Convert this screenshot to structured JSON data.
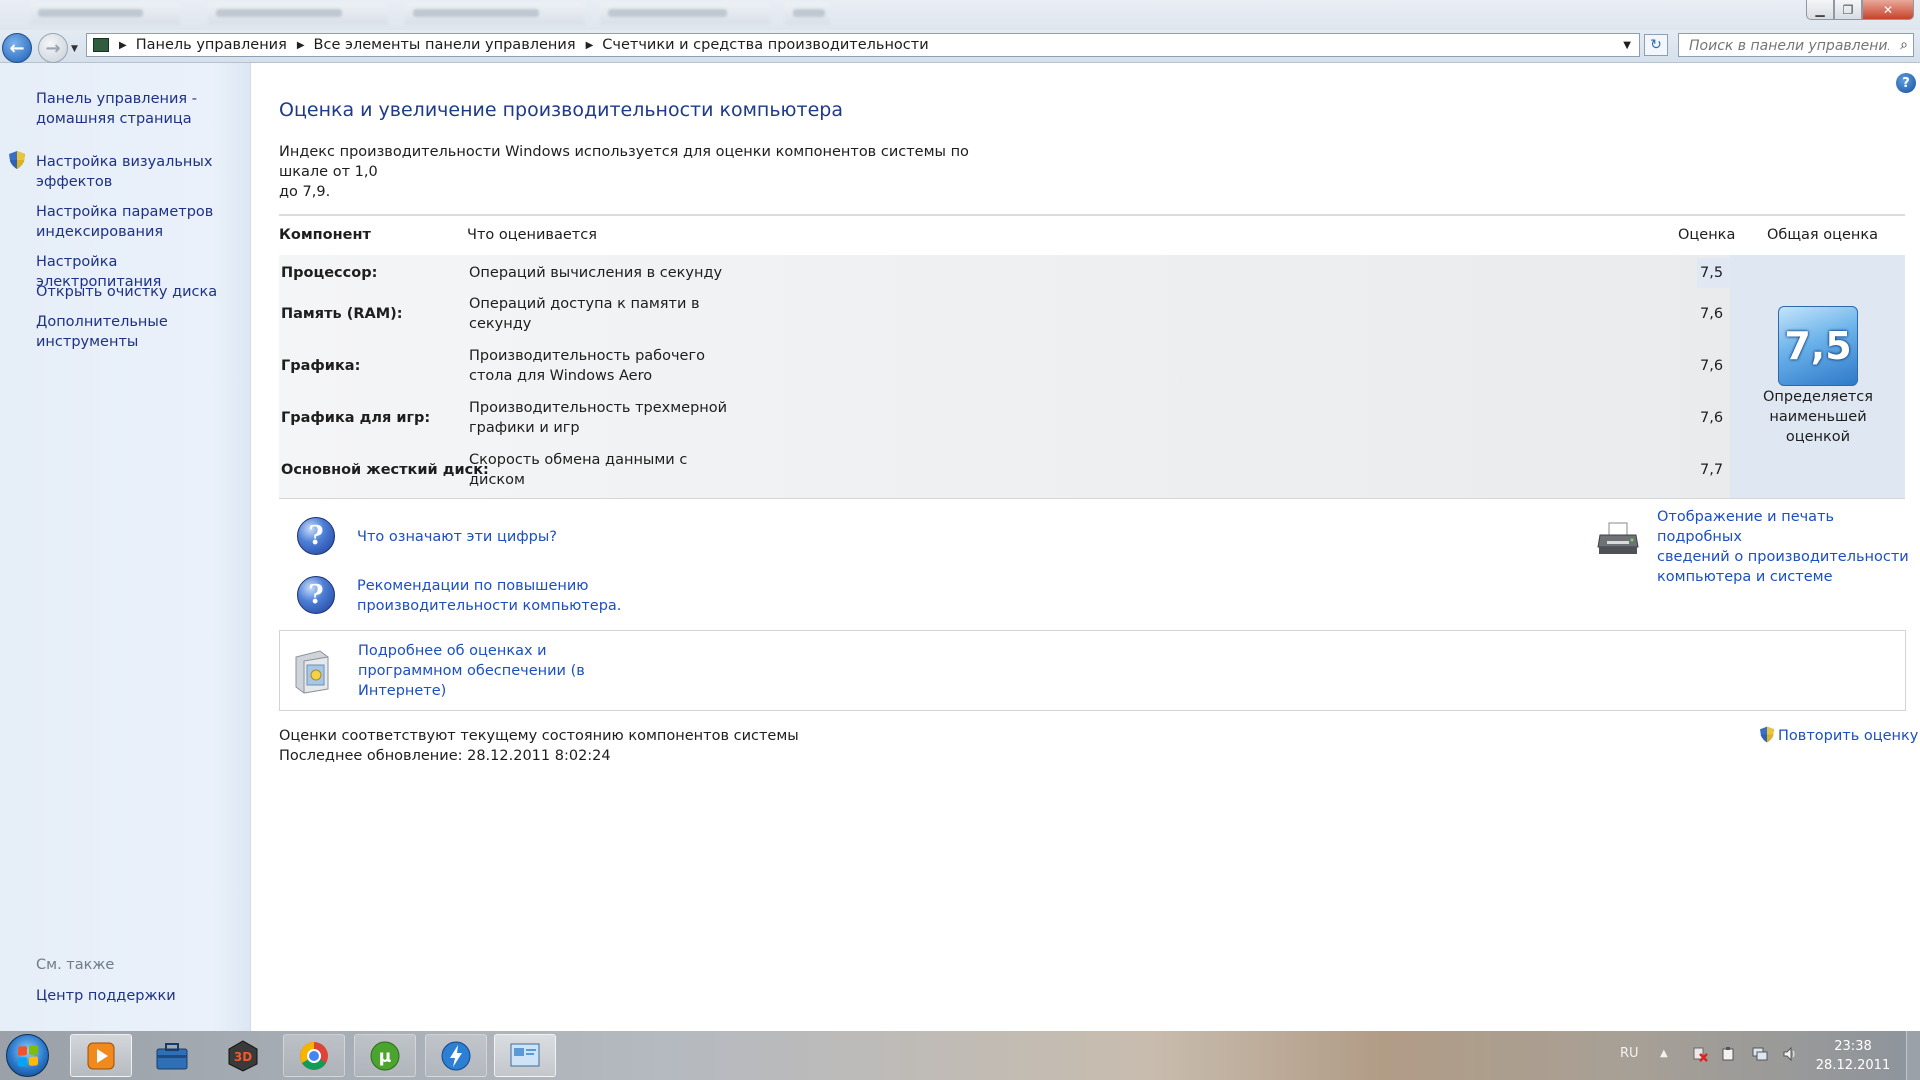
{
  "nav": {
    "breadcrumbs": [
      "Панель управления",
      "Все элементы панели управления",
      "Счетчики и средства производительности"
    ],
    "search_placeholder": "Поиск в панели управления"
  },
  "sidebar": {
    "items": [
      {
        "label_1": "Панель управления -",
        "label_2": "домашняя страница"
      },
      {
        "label_1": "Настройка визуальных",
        "label_2": "эффектов"
      },
      {
        "label_1": "Настройка параметров",
        "label_2": "индексирования"
      },
      {
        "label_1": "Настройка электропитания"
      },
      {
        "label_1": "Открыть очистку диска"
      },
      {
        "label_1": "Дополнительные",
        "label_2": "инструменты"
      }
    ],
    "see_also": "См. также",
    "support_center": "Центр поддержки"
  },
  "main": {
    "title": "Оценка и увеличение производительности компьютера",
    "intro_1": "Индекс производительности Windows используется для оценки компонентов системы по шкале от 1,0",
    "intro_2": "до 7,9.",
    "table": {
      "headers": {
        "component": "Компонент",
        "what": "Что оценивается",
        "score": "Оценка",
        "overall": "Общая оценка"
      },
      "rows": [
        {
          "name": "Процессор:",
          "what_1": "Операций вычисления в секунду",
          "what_2": "",
          "score": "7,5"
        },
        {
          "name": "Память (RAM):",
          "what_1": "Операций доступа к памяти в",
          "what_2": "секунду",
          "score": "7,6"
        },
        {
          "name": "Графика:",
          "what_1": "Производительность рабочего",
          "what_2": "стола для Windows Aero",
          "score": "7,6"
        },
        {
          "name": "Графика для игр:",
          "what_1": "Производительность трехмерной",
          "what_2": "графики и игр",
          "score": "7,6"
        },
        {
          "name": "Основной жесткий диск:",
          "what_1": "Скорость обмена данными с",
          "what_2": "диском",
          "score": "7,7"
        }
      ],
      "overall_score": "7,5",
      "overall_caption_1": "Определяется",
      "overall_caption_2": "наименьшей",
      "overall_caption_3": "оценкой"
    },
    "links": {
      "what_numbers_mean": "Что означают эти цифры?",
      "tips_1": "Рекомендации по повышению",
      "tips_2": "производительности компьютера.",
      "print_1": "Отображение и печать подробных",
      "print_2": "сведений о производительности",
      "print_3": "компьютера и системе",
      "learn_1": "Подробнее об оценках и",
      "learn_2": "программном обеспечении (в",
      "learn_3": "Интернете)"
    },
    "status_1": "Оценки соответствуют текущему состоянию компонентов системы",
    "status_2": "Последнее обновление: 28.12.2011 8:02:24",
    "rerun": "Повторить оценку"
  },
  "taskbar": {
    "language": "RU",
    "time": "23:38",
    "date": "28.12.2011"
  },
  "colors": {
    "link": "#1c4fc3",
    "sidebar_link": "#1e3287",
    "title": "#1e3a8a",
    "badge": "#3a8ad8"
  }
}
